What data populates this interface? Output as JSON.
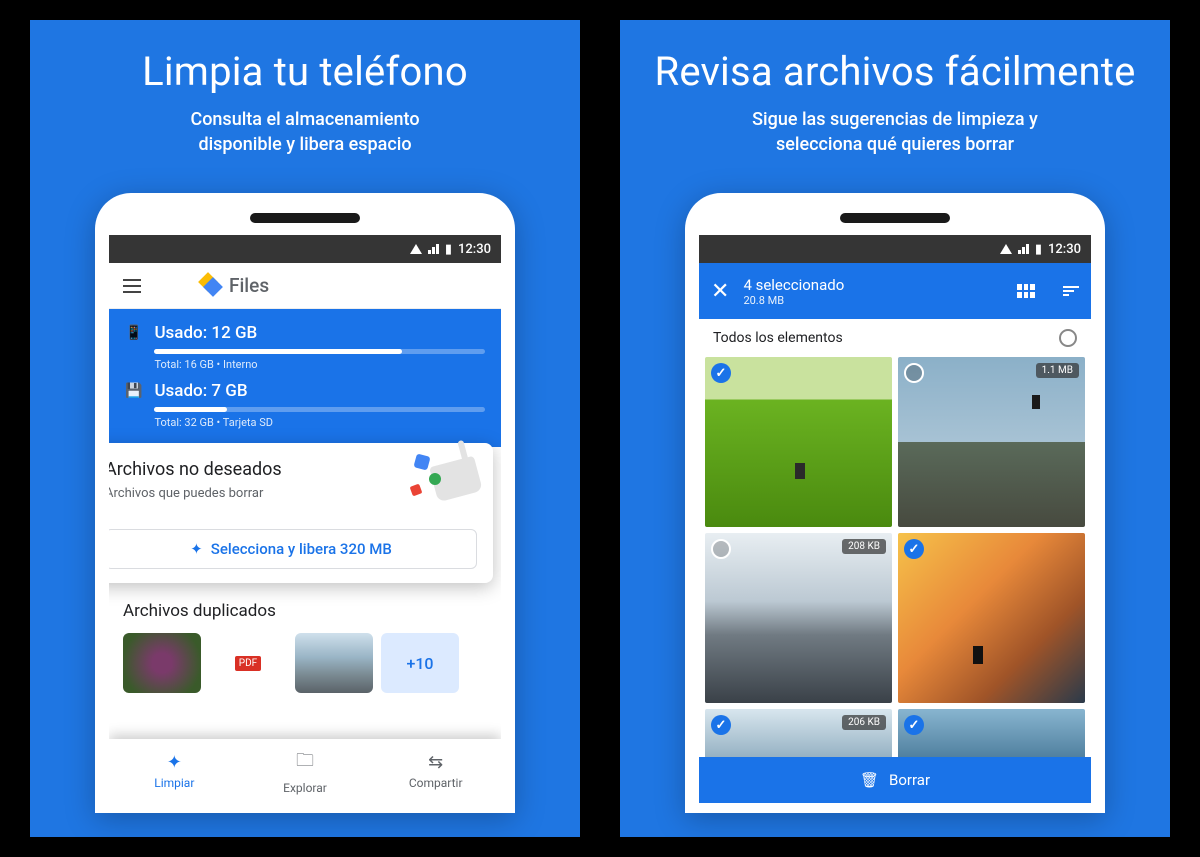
{
  "status_time": "12:30",
  "panel1": {
    "title": "Limpia tu teléfono",
    "subtitle": "Consulta el almacenamiento\ndisponible y libera espacio",
    "app_name": "Files",
    "storage_internal": {
      "used_label": "Usado: 12 GB",
      "meta": "Total: 16 GB • Interno",
      "fill_pct": 75
    },
    "storage_sd": {
      "used_label": "Usado: 7 GB",
      "meta": "Total: 32 GB • Tarjeta SD",
      "fill_pct": 22
    },
    "junk": {
      "title": "Archivos no deseados",
      "sub": "Archivos que puedes borrar",
      "cta": "Selecciona y libera 320 MB"
    },
    "duplicates_title": "Archivos duplicados",
    "more_label": "+10",
    "nav": {
      "clean": "Limpiar",
      "browse": "Explorar",
      "share": "Compartir"
    }
  },
  "panel2": {
    "title": "Revisa archivos fácilmente",
    "subtitle": "Sigue las sugerencias de limpieza y\nselecciona qué quieres borrar",
    "selection_text": "4 seleccionado",
    "selection_size": "20.8 MB",
    "all_label": "Todos los elementos",
    "photos": [
      {
        "selected": true,
        "size": "",
        "tex": "p-field"
      },
      {
        "selected": false,
        "size": "1.1 MB",
        "tex": "p-cliff"
      },
      {
        "selected": false,
        "size": "208 KB",
        "tex": "p-mtn"
      },
      {
        "selected": true,
        "size": "",
        "tex": "p-sunset"
      }
    ],
    "after_photos": [
      {
        "selected": true,
        "size": "206 KB",
        "tex": "p-path"
      },
      {
        "selected": true,
        "size": "",
        "tex": "p-sea"
      }
    ],
    "delete_label": "Borrar"
  }
}
